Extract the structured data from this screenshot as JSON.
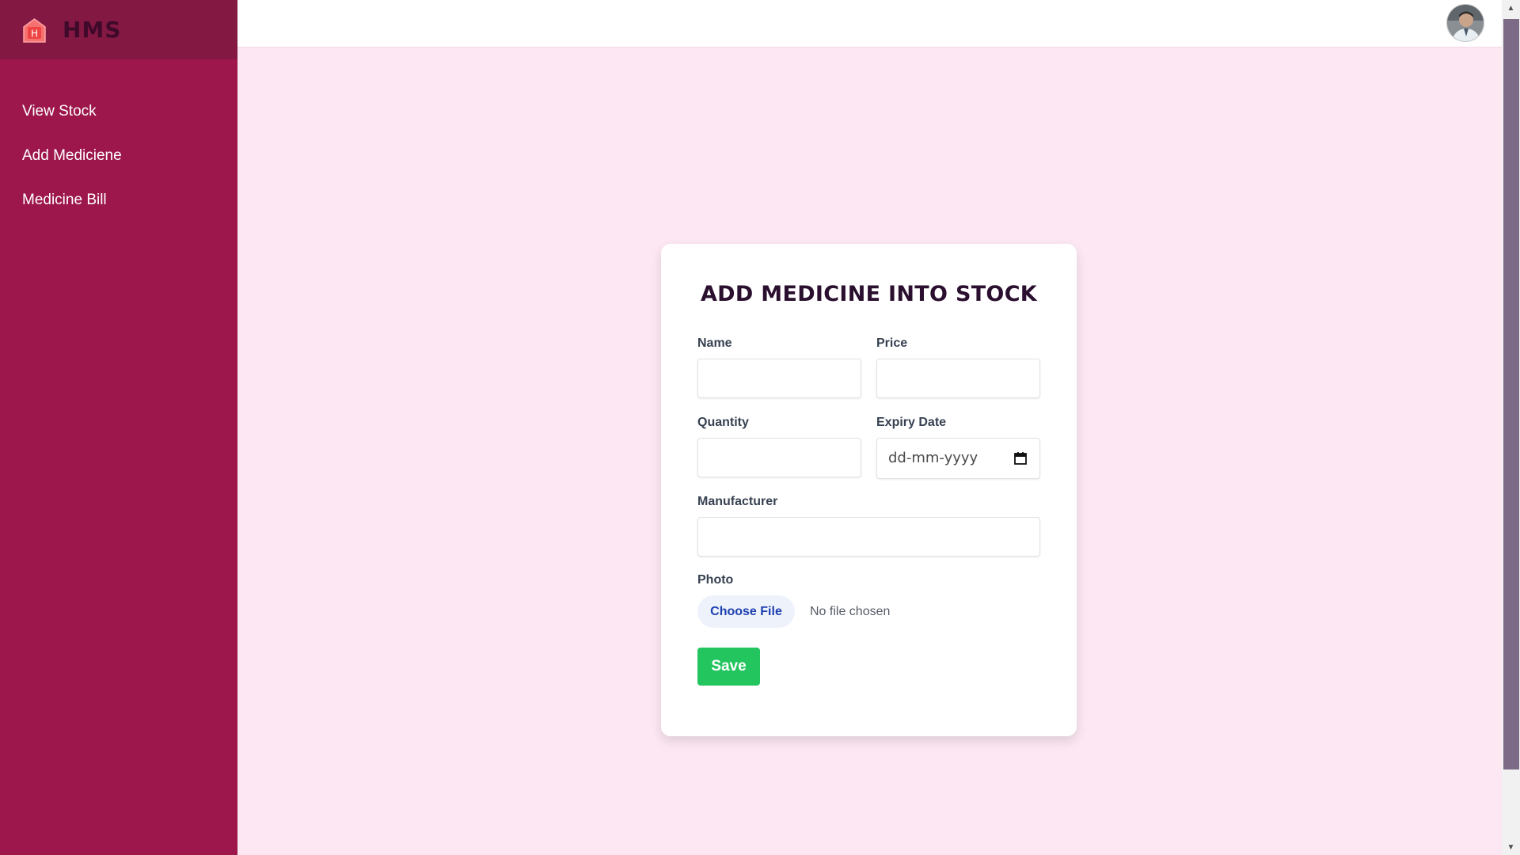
{
  "brand": {
    "title": "HMS",
    "logo_letter": "H",
    "logo_icon": "hospital-icon"
  },
  "sidebar": {
    "items": [
      {
        "label": "View Stock"
      },
      {
        "label": "Add Mediciene"
      },
      {
        "label": "Medicine Bill"
      }
    ]
  },
  "topbar": {
    "avatar_icon": "user-avatar"
  },
  "form": {
    "title": "ADD MEDICINE INTO STOCK",
    "name_label": "Name",
    "name_value": "",
    "price_label": "Price",
    "price_value": "",
    "quantity_label": "Quantity",
    "quantity_value": "",
    "expiry_label": "Expiry Date",
    "expiry_placeholder": "dd-mm-yyyy",
    "manufacturer_label": "Manufacturer",
    "manufacturer_value": "",
    "photo_label": "Photo",
    "choose_file_label": "Choose File",
    "file_status": "No file chosen",
    "save_label": "Save"
  },
  "colors": {
    "sidebar": "#9d174d",
    "sidebar_brand": "#831843",
    "page_background": "#fce7f3",
    "save_button": "#22c55e",
    "file_button_text": "#1e40af"
  }
}
